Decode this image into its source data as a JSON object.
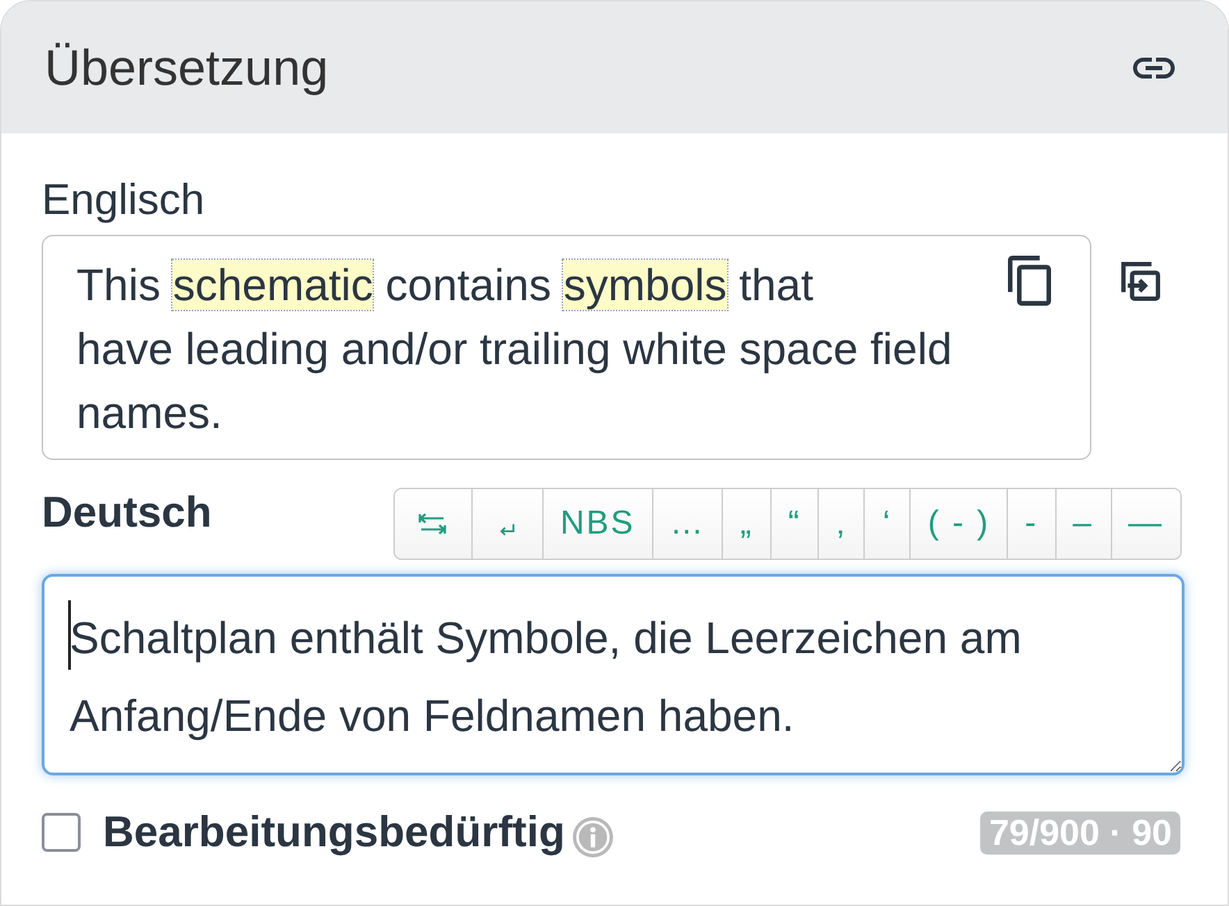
{
  "panel": {
    "title": "Übersetzung"
  },
  "source": {
    "language": "Englisch",
    "segments": [
      {
        "text": "This ",
        "highlighted": false
      },
      {
        "text": "schematic",
        "highlighted": true
      },
      {
        "text": " contains ",
        "highlighted": false
      },
      {
        "text": "symbols",
        "highlighted": true
      },
      {
        "text": " that have leading and/or trailing white space field names.",
        "highlighted": false
      }
    ]
  },
  "target": {
    "language": "Deutsch",
    "toolbar": [
      {
        "kind": "tab"
      },
      {
        "kind": "newline"
      },
      {
        "kind": "text",
        "label": "NBS"
      },
      {
        "kind": "text",
        "label": "…"
      },
      {
        "kind": "text",
        "label": "„"
      },
      {
        "kind": "text",
        "label": "“"
      },
      {
        "kind": "text",
        "label": "‚"
      },
      {
        "kind": "text",
        "label": "‘"
      },
      {
        "kind": "text",
        "label": "( - )"
      },
      {
        "kind": "text",
        "label": "-"
      },
      {
        "kind": "text",
        "label": "–"
      },
      {
        "kind": "text",
        "label": "—"
      }
    ],
    "value": "Schaltplan enthält Symbole, die Leerzeichen am Anfang/Ende von Feldnamen haben.",
    "focused": true
  },
  "needs_editing": {
    "label": "Bearbeitungsbedürftig",
    "checked": false
  },
  "counter": "79/900 · 90"
}
